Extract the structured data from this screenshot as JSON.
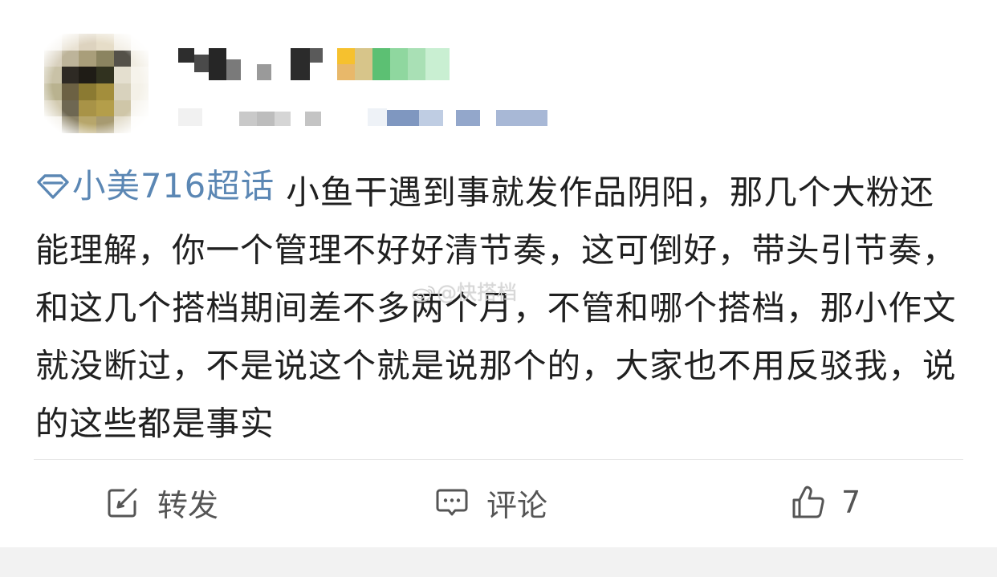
{
  "post": {
    "topic": {
      "icon": "super-topic-diamond-icon",
      "label": "小美716超话"
    },
    "text": "小鱼干遇到事就发作品阴阳，那几个大粉还能理解，你一个管理不好好清节奏，这可倒好，带头引节奏，和这几个搭档期间差不多两个月，不管和哪个搭档，那小作文就没断过，不是说这个就是说那个的，大家也不用反驳我，说的这些都是事实",
    "watermark": "@快搭档"
  },
  "actions": {
    "repost": {
      "icon": "repost-icon",
      "label": "转发"
    },
    "comment": {
      "icon": "comment-icon",
      "label": "评论"
    },
    "like": {
      "icon": "thumbs-up-icon",
      "count": "7"
    }
  },
  "colors": {
    "topic_link": "#5b87b4",
    "action_text": "#555555",
    "divider": "#e6e6e6",
    "bottom_band": "#f2f2f2"
  }
}
